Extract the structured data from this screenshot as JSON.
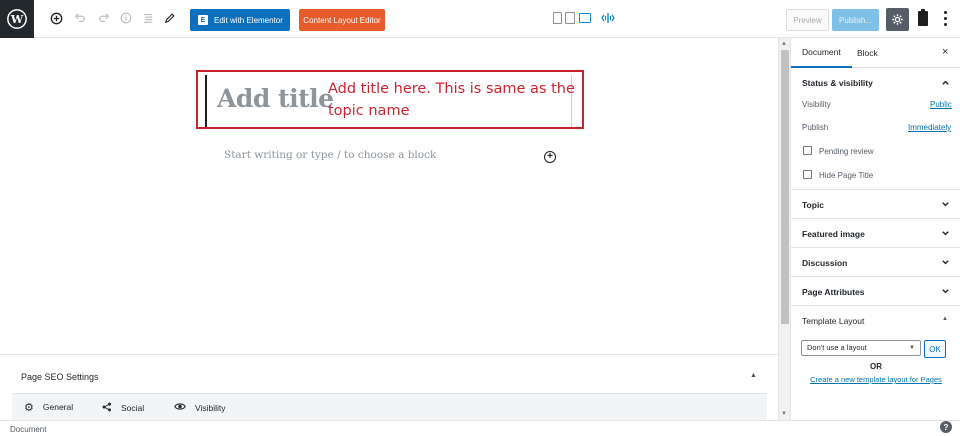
{
  "toolbar": {
    "logo_icon": "wordpress-icon",
    "add_block_icon": "plus-circle-icon",
    "undo_icon": "undo-icon",
    "redo_icon": "redo-icon",
    "info_icon": "info-icon",
    "outline_icon": "list-icon",
    "tools_icon": "pencil-icon",
    "elementor_label": "Edit with Elementor",
    "content_layout_label": "Content Layout Editor",
    "preview_label": "Preview",
    "publish_label": "Publish...",
    "settings_icon": "gear-icon",
    "clipboard_icon": "clipboard-icon",
    "more_icon": "more-vertical-icon"
  },
  "editor": {
    "title_placeholder": "Add title",
    "annotation": "Add title here. This is same as the topic name",
    "block_placeholder": "Start writing or type / to choose a block"
  },
  "seo": {
    "title": "Page SEO Settings",
    "tabs": [
      {
        "label": "General",
        "icon": "gear-icon"
      },
      {
        "label": "Social",
        "icon": "share-icon"
      },
      {
        "label": "Visibility",
        "icon": "eye-icon"
      }
    ]
  },
  "sidebar": {
    "tabs": [
      {
        "label": "Document"
      },
      {
        "label": "Block"
      }
    ],
    "close_label": "×",
    "status": {
      "heading": "Status & visibility",
      "visibility_label": "Visibility",
      "visibility_value": "Public",
      "publish_label": "Publish",
      "publish_value": "Immediately",
      "pending_review": "Pending review",
      "hide_title": "Hide Page Title"
    },
    "sections": [
      "Topic",
      "Featured image",
      "Discussion",
      "Page Attributes"
    ],
    "template": {
      "heading": "Template Layout",
      "select_value": "Don't use a layout",
      "ok_label": "OK",
      "or_label": "OR",
      "create_link": "Create a new template layout for Pages"
    }
  },
  "footer": {
    "breadcrumb": "Document",
    "help_label": "?"
  },
  "colors": {
    "accent": "#0e6fbd",
    "elementor": "#0e6fbd",
    "content_layout": "#e85b2a",
    "annotation": "#c8222f"
  }
}
